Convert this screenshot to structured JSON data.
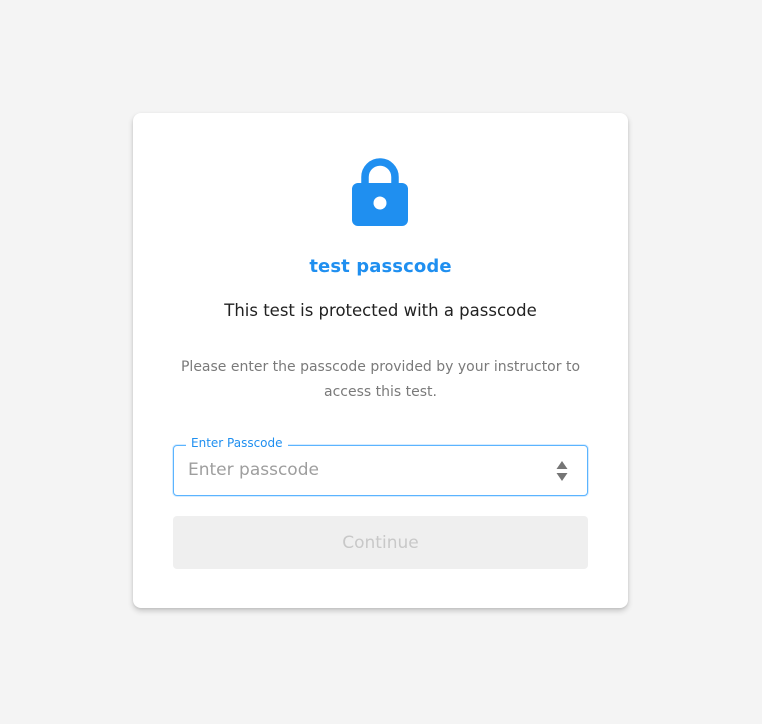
{
  "dialog": {
    "icon": "lock-icon",
    "title": "test passcode",
    "subtitle": "This test is protected with a passcode",
    "description": "Please enter the passcode provided by your instructor to access this test.",
    "field_label": "Enter Passcode",
    "input_placeholder": "Enter passcode",
    "input_value": "",
    "continue_label": "Continue",
    "continue_disabled": true
  },
  "colors": {
    "accent": "#1f8ff0",
    "background": "#f4f4f4",
    "card": "#ffffff",
    "button_disabled_bg": "#efefef",
    "button_disabled_text": "#c8c8c8"
  }
}
